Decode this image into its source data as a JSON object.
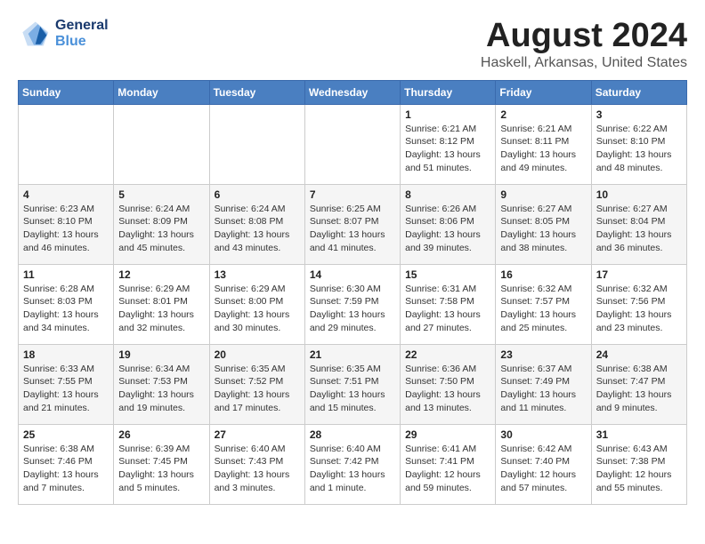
{
  "header": {
    "logo_line1": "General",
    "logo_line2": "Blue",
    "title": "August 2024",
    "subtitle": "Haskell, Arkansas, United States"
  },
  "weekdays": [
    "Sunday",
    "Monday",
    "Tuesday",
    "Wednesday",
    "Thursday",
    "Friday",
    "Saturday"
  ],
  "weeks": [
    [
      {
        "day": "",
        "info": ""
      },
      {
        "day": "",
        "info": ""
      },
      {
        "day": "",
        "info": ""
      },
      {
        "day": "",
        "info": ""
      },
      {
        "day": "1",
        "info": "Sunrise: 6:21 AM\nSunset: 8:12 PM\nDaylight: 13 hours\nand 51 minutes."
      },
      {
        "day": "2",
        "info": "Sunrise: 6:21 AM\nSunset: 8:11 PM\nDaylight: 13 hours\nand 49 minutes."
      },
      {
        "day": "3",
        "info": "Sunrise: 6:22 AM\nSunset: 8:10 PM\nDaylight: 13 hours\nand 48 minutes."
      }
    ],
    [
      {
        "day": "4",
        "info": "Sunrise: 6:23 AM\nSunset: 8:10 PM\nDaylight: 13 hours\nand 46 minutes."
      },
      {
        "day": "5",
        "info": "Sunrise: 6:24 AM\nSunset: 8:09 PM\nDaylight: 13 hours\nand 45 minutes."
      },
      {
        "day": "6",
        "info": "Sunrise: 6:24 AM\nSunset: 8:08 PM\nDaylight: 13 hours\nand 43 minutes."
      },
      {
        "day": "7",
        "info": "Sunrise: 6:25 AM\nSunset: 8:07 PM\nDaylight: 13 hours\nand 41 minutes."
      },
      {
        "day": "8",
        "info": "Sunrise: 6:26 AM\nSunset: 8:06 PM\nDaylight: 13 hours\nand 39 minutes."
      },
      {
        "day": "9",
        "info": "Sunrise: 6:27 AM\nSunset: 8:05 PM\nDaylight: 13 hours\nand 38 minutes."
      },
      {
        "day": "10",
        "info": "Sunrise: 6:27 AM\nSunset: 8:04 PM\nDaylight: 13 hours\nand 36 minutes."
      }
    ],
    [
      {
        "day": "11",
        "info": "Sunrise: 6:28 AM\nSunset: 8:03 PM\nDaylight: 13 hours\nand 34 minutes."
      },
      {
        "day": "12",
        "info": "Sunrise: 6:29 AM\nSunset: 8:01 PM\nDaylight: 13 hours\nand 32 minutes."
      },
      {
        "day": "13",
        "info": "Sunrise: 6:29 AM\nSunset: 8:00 PM\nDaylight: 13 hours\nand 30 minutes."
      },
      {
        "day": "14",
        "info": "Sunrise: 6:30 AM\nSunset: 7:59 PM\nDaylight: 13 hours\nand 29 minutes."
      },
      {
        "day": "15",
        "info": "Sunrise: 6:31 AM\nSunset: 7:58 PM\nDaylight: 13 hours\nand 27 minutes."
      },
      {
        "day": "16",
        "info": "Sunrise: 6:32 AM\nSunset: 7:57 PM\nDaylight: 13 hours\nand 25 minutes."
      },
      {
        "day": "17",
        "info": "Sunrise: 6:32 AM\nSunset: 7:56 PM\nDaylight: 13 hours\nand 23 minutes."
      }
    ],
    [
      {
        "day": "18",
        "info": "Sunrise: 6:33 AM\nSunset: 7:55 PM\nDaylight: 13 hours\nand 21 minutes."
      },
      {
        "day": "19",
        "info": "Sunrise: 6:34 AM\nSunset: 7:53 PM\nDaylight: 13 hours\nand 19 minutes."
      },
      {
        "day": "20",
        "info": "Sunrise: 6:35 AM\nSunset: 7:52 PM\nDaylight: 13 hours\nand 17 minutes."
      },
      {
        "day": "21",
        "info": "Sunrise: 6:35 AM\nSunset: 7:51 PM\nDaylight: 13 hours\nand 15 minutes."
      },
      {
        "day": "22",
        "info": "Sunrise: 6:36 AM\nSunset: 7:50 PM\nDaylight: 13 hours\nand 13 minutes."
      },
      {
        "day": "23",
        "info": "Sunrise: 6:37 AM\nSunset: 7:49 PM\nDaylight: 13 hours\nand 11 minutes."
      },
      {
        "day": "24",
        "info": "Sunrise: 6:38 AM\nSunset: 7:47 PM\nDaylight: 13 hours\nand 9 minutes."
      }
    ],
    [
      {
        "day": "25",
        "info": "Sunrise: 6:38 AM\nSunset: 7:46 PM\nDaylight: 13 hours\nand 7 minutes."
      },
      {
        "day": "26",
        "info": "Sunrise: 6:39 AM\nSunset: 7:45 PM\nDaylight: 13 hours\nand 5 minutes."
      },
      {
        "day": "27",
        "info": "Sunrise: 6:40 AM\nSunset: 7:43 PM\nDaylight: 13 hours\nand 3 minutes."
      },
      {
        "day": "28",
        "info": "Sunrise: 6:40 AM\nSunset: 7:42 PM\nDaylight: 13 hours\nand 1 minute."
      },
      {
        "day": "29",
        "info": "Sunrise: 6:41 AM\nSunset: 7:41 PM\nDaylight: 12 hours\nand 59 minutes."
      },
      {
        "day": "30",
        "info": "Sunrise: 6:42 AM\nSunset: 7:40 PM\nDaylight: 12 hours\nand 57 minutes."
      },
      {
        "day": "31",
        "info": "Sunrise: 6:43 AM\nSunset: 7:38 PM\nDaylight: 12 hours\nand 55 minutes."
      }
    ]
  ]
}
